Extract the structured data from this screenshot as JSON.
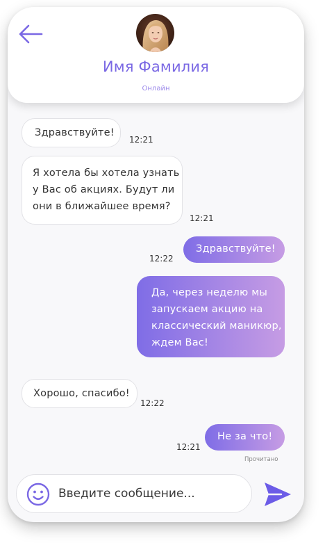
{
  "header": {
    "contact_name": "Имя Фамилия",
    "status": "Онлайн",
    "avatar_icon": "avatar-photo"
  },
  "messages": [
    {
      "direction": "incoming",
      "text": "Здравствуйте!",
      "time": "12:21"
    },
    {
      "direction": "incoming",
      "lines": [
        "Я хотела бы хотела узнать",
        "у Вас об акциях. Будут ли",
        "они в ближайшее время?"
      ],
      "time": "12:21"
    },
    {
      "direction": "outgoing",
      "text": "Здравствуйте!",
      "time": "12:22"
    },
    {
      "direction": "outgoing",
      "lines": [
        "Да, через неделю мы",
        "запускаем акцию на",
        "классический маникюр,",
        "ждем Вас!"
      ]
    },
    {
      "direction": "incoming",
      "text": "Хорошо, спасибо!",
      "time": "12:22"
    },
    {
      "direction": "outgoing",
      "text": "Не за что!",
      "time": "12:21",
      "read_receipt": "Прочитано"
    }
  ],
  "composer": {
    "placeholder": "Введите сообщение...",
    "emoji_icon": "smiley-icon",
    "send_icon": "paper-plane-icon"
  },
  "colors": {
    "accent": "#7a68e4",
    "bubble_gradient_start": "#7f6de6",
    "bubble_gradient_end": "#c69ce4",
    "incoming_bubble": "#ffffff",
    "background": "#f8f8fa"
  }
}
